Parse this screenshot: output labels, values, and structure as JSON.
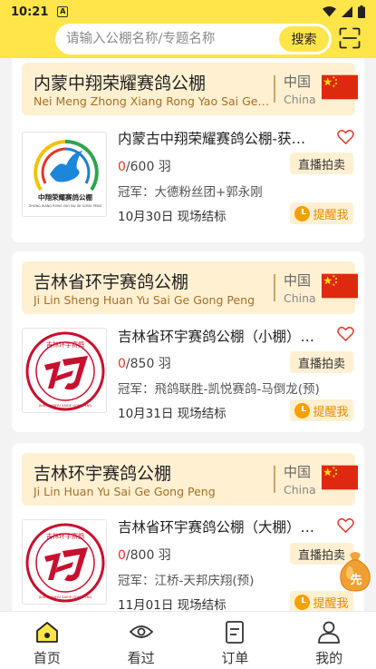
{
  "status_bar": {
    "time": "10:21",
    "notification_badge": "A"
  },
  "search": {
    "placeholder": "请输入公棚名称/专题名称",
    "button_label": "搜索"
  },
  "cards": [
    {
      "title": "内蒙中翔荣耀赛鸽公棚",
      "pinyin": "Nei Meng Zhong Xiang Rong Yao Sai Ge Gong Peng",
      "country": "中国",
      "country_en": "China",
      "item_title": "内蒙古中翔荣耀赛鸽公棚-获奖鸽拍卖",
      "count_current": "0",
      "count_rest": "/600 羽",
      "live_label": "直播拍卖",
      "champion": "冠军：大德粉丝团+郭永刚",
      "date": "10月30日 现场结标",
      "remind_label": "提醒我",
      "logo_caption": "中翔荣耀赛鸽公棚",
      "logo_caption_en": "ZHONG XIANG RONG YAO SAI GE GONG PENG"
    },
    {
      "title": "吉林省环宇赛鸽公棚",
      "pinyin": "Ji Lin Sheng Huan Yu Sai Ge Gong Peng",
      "country": "中国",
      "country_en": "China",
      "item_title": "吉林省环宇赛鸽公棚（小棚）决赛拍卖",
      "count_current": "0",
      "count_rest": "/850 羽",
      "live_label": "直播拍卖",
      "champion": "冠军：飛鸽联胜-凯悦赛鸽-马倒龙(预)",
      "date": "10月31日 现场结标",
      "remind_label": "提醒我",
      "logo_caption": "吉林环宇赛鸽",
      "logo_caption_en": "JILIN HUANYU SAIGE GONGPENG"
    },
    {
      "title": "吉林环宇赛鸽公棚",
      "pinyin": "Ji Lin Huan Yu Sai Ge Gong Peng",
      "country": "中国",
      "country_en": "China",
      "item_title": "吉林省环宇赛鸽公棚（大棚）决赛拍卖",
      "count_current": "0",
      "count_rest": "/800 羽",
      "live_label": "直播拍卖",
      "champion": "冠军：江桥-天邦庆翔(预)",
      "date": "11月01日 现场结标",
      "remind_label": "提醒我",
      "logo_caption": "吉林环宇赛鸽",
      "logo_caption_en": "JILIN HUANYU SAIGE GONGPENG"
    }
  ],
  "float_button": {
    "label": "先"
  },
  "nav": [
    {
      "label": "首页",
      "icon": "home-icon",
      "active": true
    },
    {
      "label": "看过",
      "icon": "eye-icon"
    },
    {
      "label": "订单",
      "icon": "order-icon"
    },
    {
      "label": "我的",
      "icon": "user-icon"
    }
  ],
  "colors": {
    "brand_yellow": "#ffe54a",
    "header_bg": "#fff0d2",
    "accent_orange": "#f4a100",
    "price_red": "#e23a2a"
  }
}
